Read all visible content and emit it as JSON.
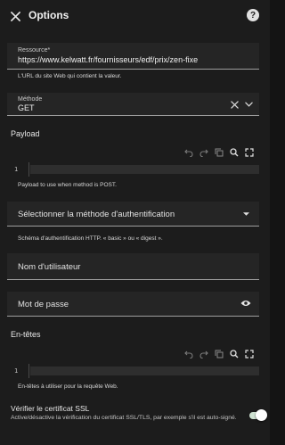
{
  "header": {
    "title": "Options",
    "help_glyph": "?"
  },
  "resource": {
    "label": "Ressource*",
    "value": "https://www.kelwatt.fr/fournisseurs/edf/prix/zen-fixe",
    "helper": "L'URL du site Web qui contient la valeur."
  },
  "method": {
    "label": "Méthode",
    "value": "GET"
  },
  "payload": {
    "section_title": "Payload",
    "line_number": "1",
    "helper": "Payload to use when method is POST."
  },
  "auth": {
    "placeholder": "Sélectionner la méthode d'authentification",
    "helper": "Schéma d'authentification HTTP. « basic » ou « digest »."
  },
  "username": {
    "placeholder": "Nom d'utilisateur"
  },
  "password": {
    "placeholder": "Mot de passe"
  },
  "headers": {
    "section_title": "En-têtes",
    "line_number": "1",
    "helper": "En-têtes à utiliser pour la requête Web."
  },
  "ssl": {
    "title": "Vérifier le certificat SSL",
    "description": "Active/désactive la vérification du certificat SSL/TLS, par exemple s'il est auto-signé.",
    "enabled": true
  },
  "colors": {
    "background": "#1c1c1c",
    "field_background": "#252525",
    "toggle_on": "#cfe2d2"
  }
}
